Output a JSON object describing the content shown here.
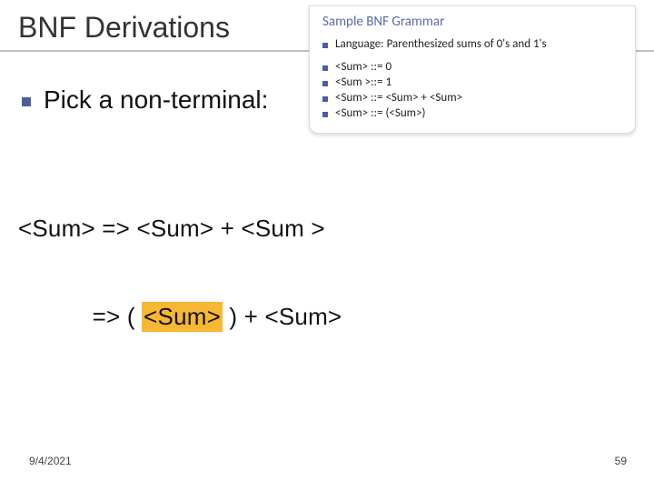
{
  "title": "BNF Derivations",
  "bullet": "Pick a non-terminal:",
  "derivation": {
    "line1_pre": "<Sum> => <Sum> + <Sum >",
    "line2_pre": "           => ( ",
    "line2_hl": "<Sum>",
    "line2_post": " ) + <Sum>"
  },
  "inset": {
    "title": "Sample BNF Grammar",
    "rows": [
      "Language: Parenthesized sums of 0's and 1's",
      "",
      "<Sum> ::= 0",
      "<Sum >::= 1",
      "<Sum> ::= <Sum> + <Sum>",
      "<Sum> ::= (<Sum>)"
    ]
  },
  "footer": {
    "date": "9/4/2021",
    "page": "59"
  }
}
